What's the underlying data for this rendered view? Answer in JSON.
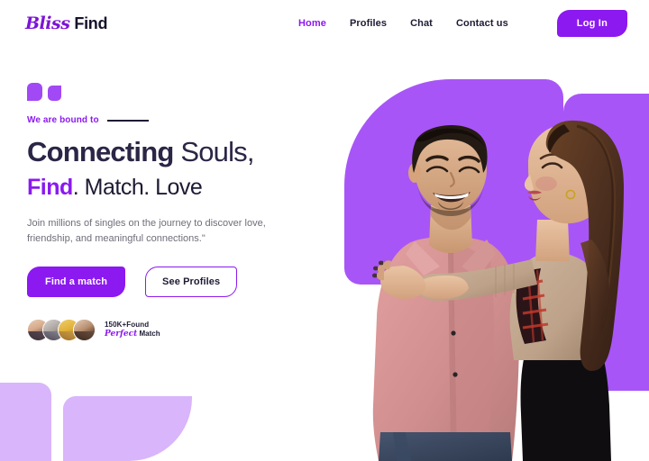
{
  "brand": {
    "script_part": "Bliss",
    "bold_part": "Find"
  },
  "header": {
    "nav": [
      {
        "label": "Home",
        "active": true
      },
      {
        "label": "Profiles",
        "active": false
      },
      {
        "label": "Chat",
        "active": false
      },
      {
        "label": "Contact us",
        "active": false
      }
    ],
    "login_label": "Log In"
  },
  "hero": {
    "eyebrow": "We are bound to",
    "headline_line1_strong": "Connecting",
    "headline_line1_light": "Souls,",
    "headline_line2_accent": "Find",
    "headline_line2_rest": ". Match. Love",
    "subtext": "Join millions of singles on the journey to discover love, friendship, and meaningful connections.\"",
    "primary_cta": "Find a match",
    "secondary_cta": "See Profiles",
    "stat_line1": "150K+Found",
    "stat_script": "Perfect",
    "stat_line2_rest": "Match",
    "avatar_count": 4
  },
  "colors": {
    "accent_purple": "#8b19f0",
    "blob_purple": "#a855f7",
    "blob_light_purple": "#d9b5fb",
    "dark_navy": "#1d1b33",
    "body_text": "#6e6e7a",
    "avatar_gold": "#e3b63a"
  }
}
